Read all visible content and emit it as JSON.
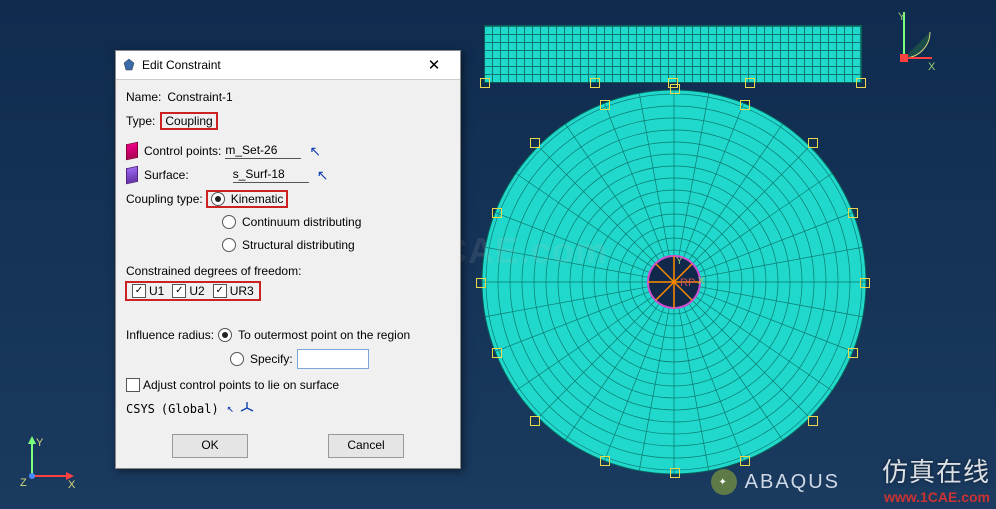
{
  "dialog": {
    "title": "Edit Constraint",
    "name_lbl": "Name:",
    "name_val": "Constraint-1",
    "type_lbl": "Type:",
    "type_val": "Coupling",
    "cp_lbl": "Control points:",
    "cp_val": "m_Set-26",
    "surf_lbl": "Surface:",
    "surf_val": "s_Surf-18",
    "coupling_type_lbl": "Coupling type:",
    "coupling_options": {
      "kinematic": "Kinematic",
      "continuum": "Continuum distributing",
      "structural": "Structural distributing"
    },
    "dof_section": "Constrained degrees of freedom:",
    "dof": {
      "u1": "U1",
      "u2": "U2",
      "ur3": "UR3"
    },
    "radius_lbl": "Influence radius:",
    "radius_outer": "To outermost point on the region",
    "radius_specify": "Specify:",
    "adjust_lbl": "Adjust control points to lie on surface",
    "csys_lbl": "CSYS",
    "csys_val": "(Global)",
    "ok": "OK",
    "cancel": "Cancel"
  },
  "triad": {
    "x": "X",
    "y": "Y",
    "z": "Z"
  },
  "rp_label": "RP",
  "watermark": "1CAE.com",
  "watermark_br1": "仿真在线",
  "watermark_br2": "www.1CAE.com",
  "logo": "ABAQUS"
}
